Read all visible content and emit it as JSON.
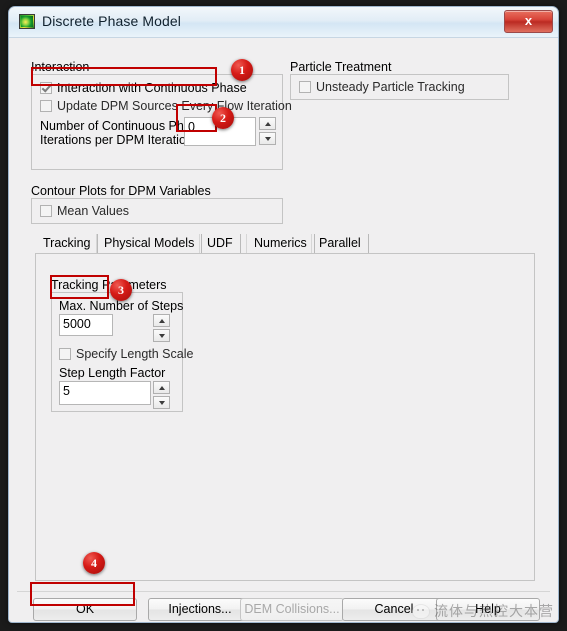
{
  "window": {
    "title": "Discrete Phase Model",
    "icon": "contour-plot-icon",
    "close_label": "x"
  },
  "interaction": {
    "group_label": "Interaction",
    "checkboxes": [
      {
        "label": "Interaction with Continuous Phase",
        "checked": true
      },
      {
        "label": "Update DPM Sources Every Flow Iteration",
        "checked": false
      }
    ],
    "iterations_label_line1": "Number of Continuous Phase",
    "iterations_label_line2": "Iterations per DPM Iteration",
    "iterations_value": "0"
  },
  "particle_treatment": {
    "group_label": "Particle Treatment",
    "checkboxes": [
      {
        "label": "Unsteady Particle Tracking",
        "checked": false
      }
    ]
  },
  "contour_plots": {
    "group_label": "Contour Plots for DPM Variables",
    "checkboxes": [
      {
        "label": "Mean Values",
        "checked": false
      }
    ]
  },
  "tabs": [
    {
      "label": "Tracking",
      "active": true
    },
    {
      "label": "Physical Models",
      "active": false
    },
    {
      "label": "UDF",
      "active": false
    },
    {
      "label": "Numerics",
      "active": false
    },
    {
      "label": "Parallel",
      "active": false
    }
  ],
  "tracking_parameters": {
    "group_label": "Tracking Parameters",
    "max_steps_label": "Max. Number of Steps",
    "max_steps_value": "5000",
    "specify_length_scale_label": "Specify Length Scale",
    "specify_length_scale_checked": false,
    "step_length_factor_label": "Step Length Factor",
    "step_length_factor_value": "5"
  },
  "buttons": [
    {
      "label": "OK",
      "disabled": false
    },
    {
      "label": "Injections...",
      "disabled": false
    },
    {
      "label": "DEM Collisions...",
      "disabled": true
    },
    {
      "label": "Cancel",
      "disabled": false
    },
    {
      "label": "Help",
      "disabled": false
    }
  ],
  "annotations": {
    "badges": [
      {
        "number": "1"
      },
      {
        "number": "2"
      },
      {
        "number": "3"
      },
      {
        "number": "4"
      }
    ],
    "highlight_color": "#c00000",
    "badge_color": "#d61b17"
  },
  "watermark": {
    "text": "流体与热控大本营",
    "icon": "wechat-icon"
  }
}
